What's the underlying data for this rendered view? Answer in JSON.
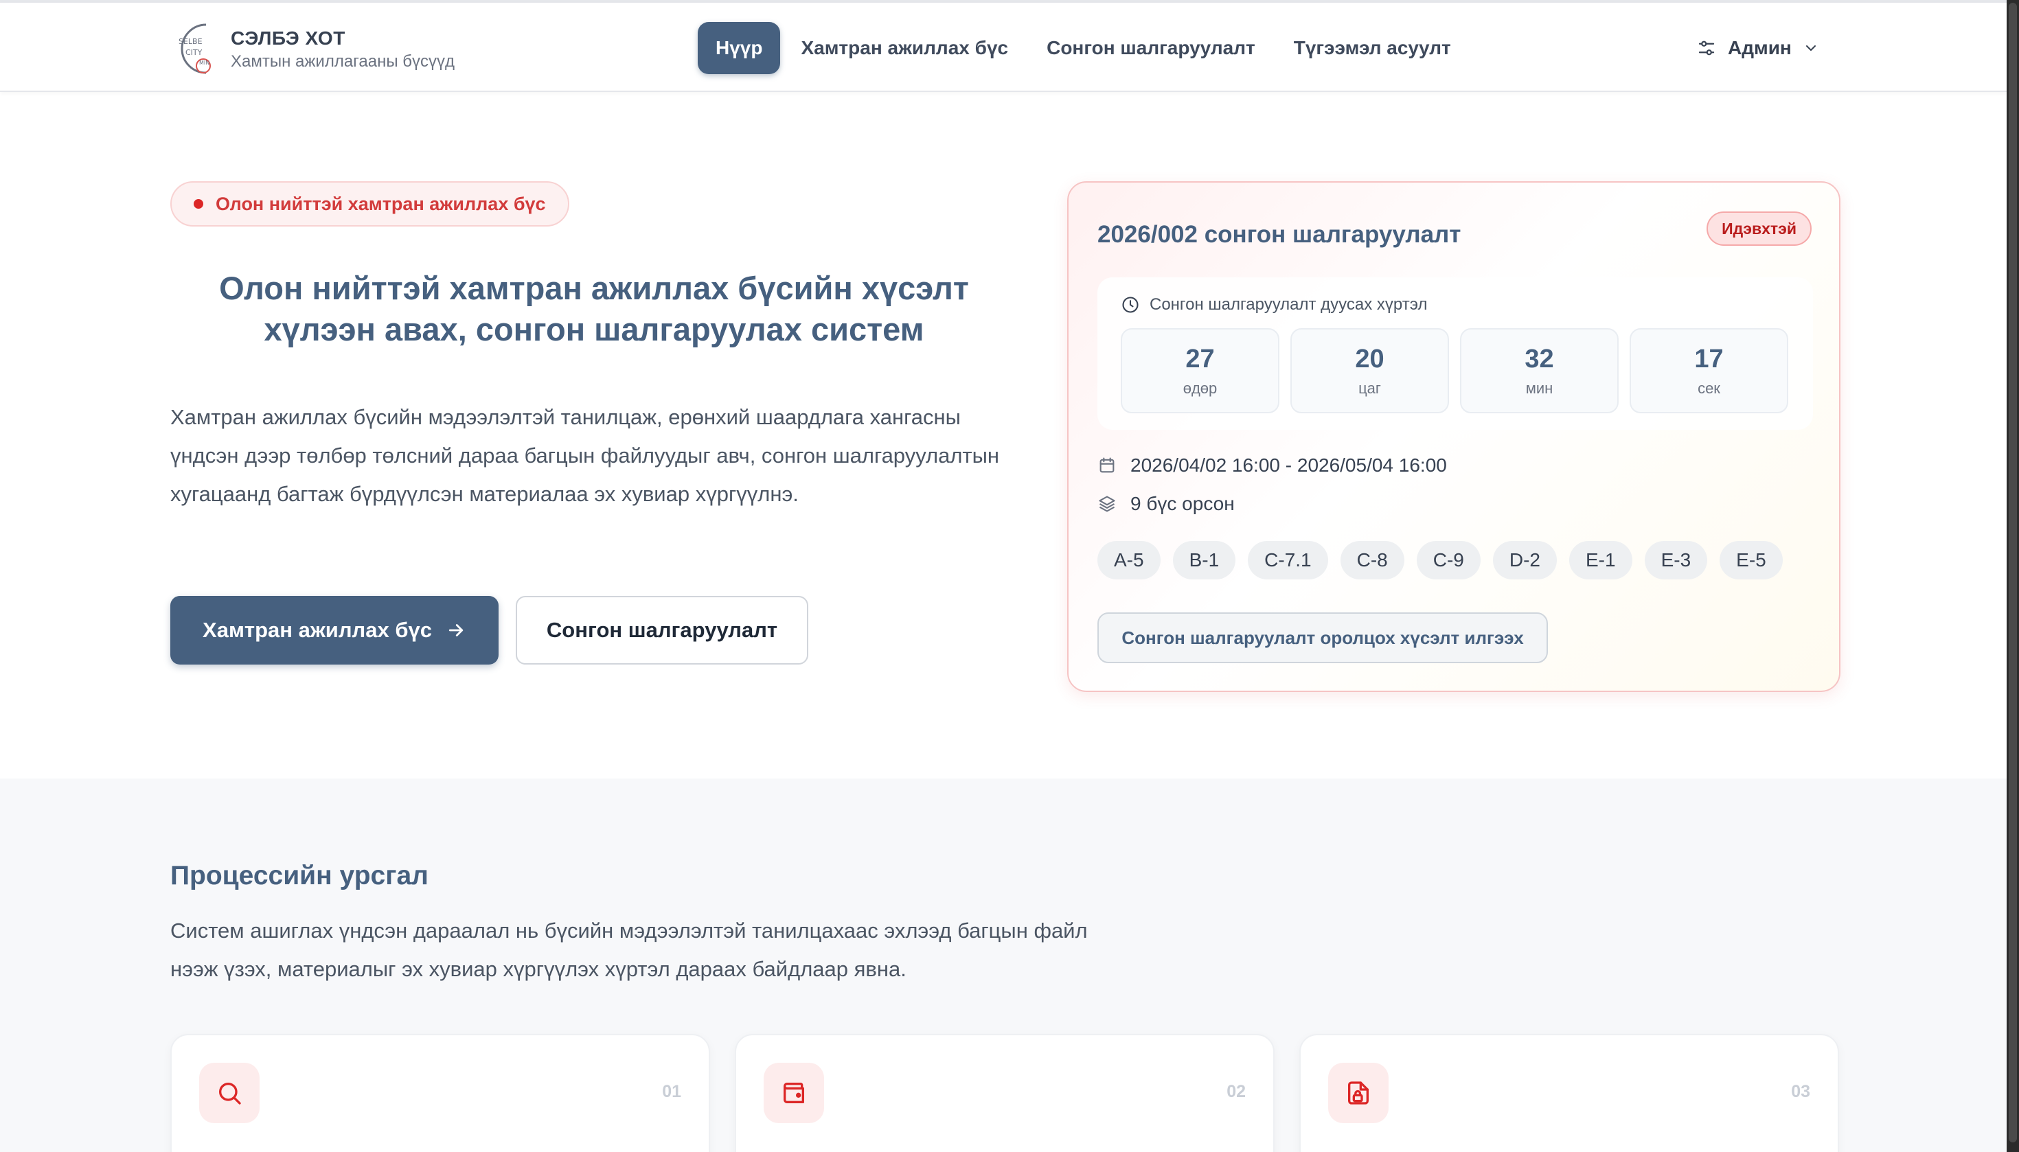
{
  "header": {
    "brand_title": "СЭЛБЭ ХОТ",
    "brand_sub": "Хамтын ажиллагааны бүсүүд",
    "logo_text_top": "SELBE",
    "logo_text_mid": "CITY",
    "logo_text_bottom": "MIN",
    "nav": [
      {
        "label": "Нүүр",
        "active": true
      },
      {
        "label": "Хамтран ажиллах бүс"
      },
      {
        "label": "Сонгон шалгаруулалт"
      },
      {
        "label": "Түгээмэл асуулт"
      }
    ],
    "user_label": "Админ"
  },
  "hero": {
    "pill_label": "Олон нийттэй хамтран ажиллах бүс",
    "title": "Олон нийттэй хамтран ажиллах бүсийн хүсэлт хүлээн авах, сонгон шалгаруулах систем",
    "description": "Хамтран ажиллах бүсийн мэдээлэлтэй танилцаж, ерөнхий шаардлага хангасны үндсэн дээр төлбөр төлсний дараа багцын файлуудыг авч, сонгон шалгаруулалтын хугацаанд багтаж бүрдүүлсэн материалаа эх хувиар хүргүүлнэ.",
    "primary_button": "Хамтран ажиллах бүс",
    "secondary_button": "Сонгон шалгаруулалт"
  },
  "card": {
    "title": "2026/002 сонгон шалгаруулалт",
    "status": "Идэвхтэй",
    "countdown_label": "Сонгон шалгаруулалт дуусах хүртэл",
    "countdown": [
      {
        "value": "27",
        "unit": "өдөр"
      },
      {
        "value": "20",
        "unit": "цаг"
      },
      {
        "value": "32",
        "unit": "мин"
      },
      {
        "value": "17",
        "unit": "сек"
      }
    ],
    "date_range": "2026/04/02 16:00 - 2026/05/04 16:00",
    "zones_count": "9 бүс орсон",
    "zones": [
      "A-5",
      "B-1",
      "C-7.1",
      "C-8",
      "C-9",
      "D-2",
      "E-1",
      "E-3",
      "E-5"
    ],
    "apply_button": "Сонгон шалгаруулалт оролцох хүсэлт илгээх"
  },
  "process": {
    "title": "Процессийн урсгал",
    "description": "Систем ашиглах үндсэн дараалал нь бүсийн мэдээлэлтэй танилцахаас эхлээд багцын файл нээж үзэх, материалыг эх хувиар хүргүүлэх хүртэл дараах байдлаар явна.",
    "steps": [
      {
        "num": "01",
        "icon": "search-icon"
      },
      {
        "num": "02",
        "icon": "wallet-icon"
      },
      {
        "num": "03",
        "icon": "file-lock-icon"
      }
    ]
  },
  "colors": {
    "primary": "#46607f",
    "accent_red": "#dc2626",
    "badge_bg": "#fde2e2"
  }
}
